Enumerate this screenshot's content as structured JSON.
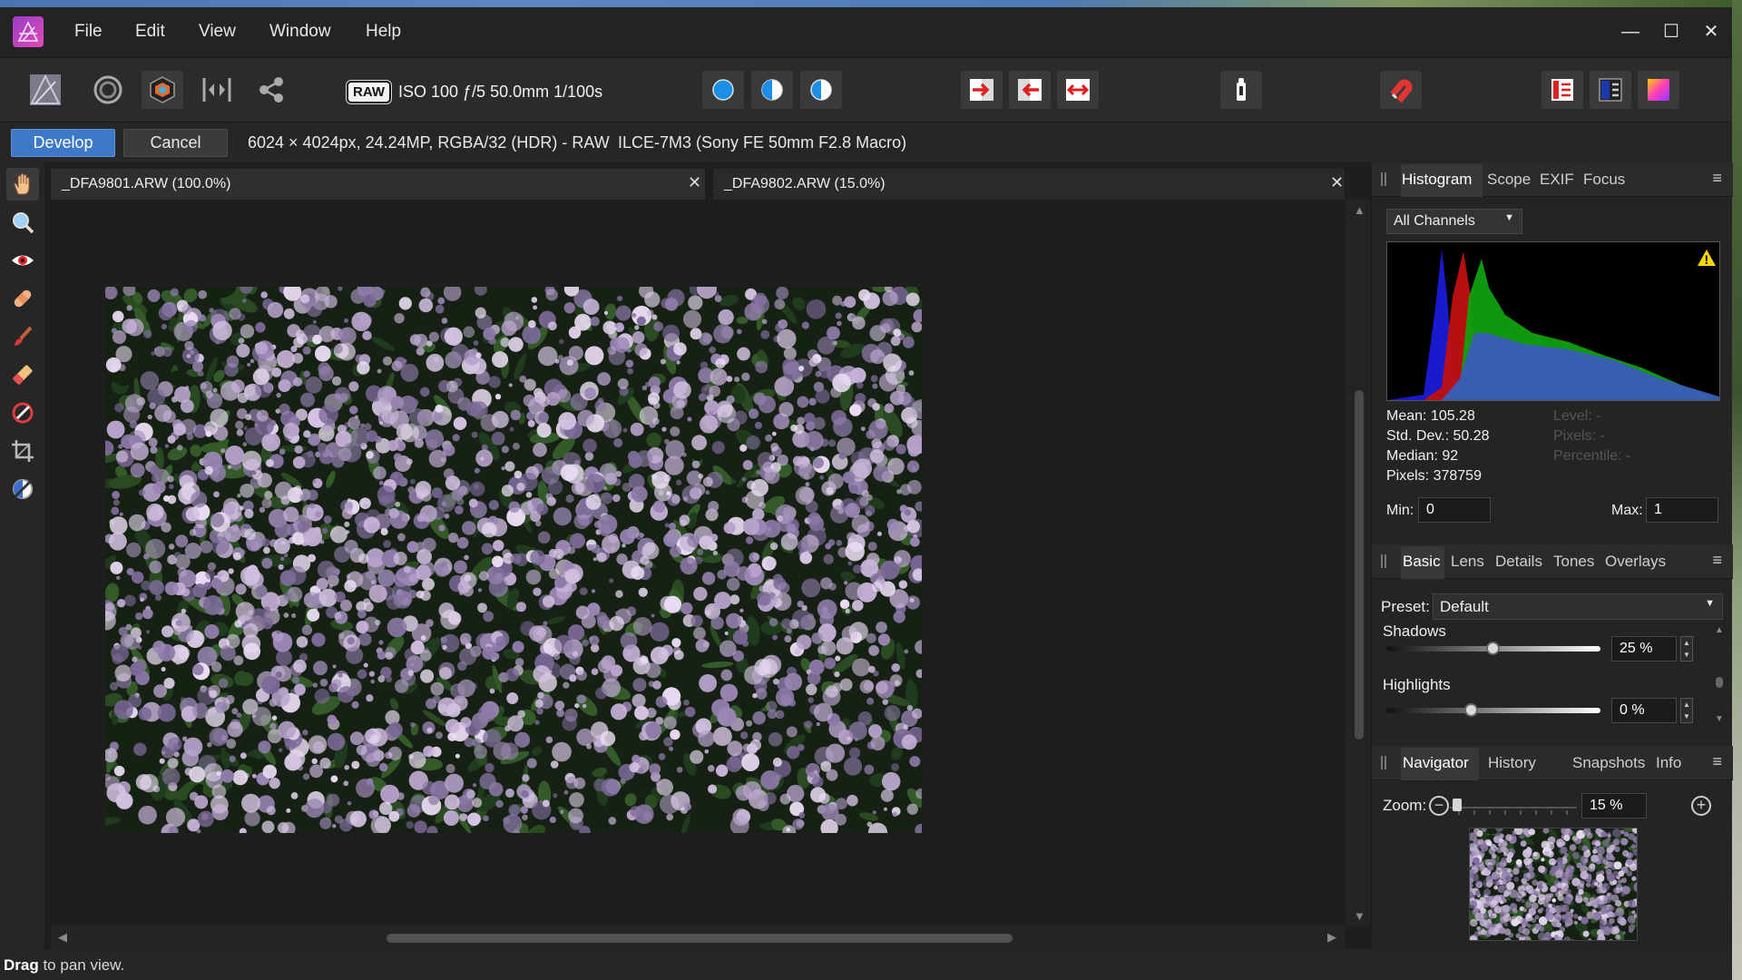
{
  "menu": {
    "items": [
      "File",
      "Edit",
      "View",
      "Window",
      "Help"
    ]
  },
  "window_controls": {
    "minimize": "—",
    "maximize": "☐",
    "close": "✕"
  },
  "toolbar": {
    "raw_badge": "RAW",
    "exposure_info": "ISO 100 ƒ/5 50.0mm 1/100s"
  },
  "context_bar": {
    "develop_label": "Develop",
    "cancel_label": "Cancel",
    "image_info": "6024 × 4024px, 24.24MP, RGBA/32 (HDR) - RAW",
    "camera_info": "ILCE-7M3 (Sony FE 50mm F2.8 Macro)"
  },
  "documents": [
    {
      "label": "_DFA9801.ARW (100.0%)",
      "close": "✕"
    },
    {
      "label": "_DFA9802.ARW (15.0%)",
      "close": "✕"
    }
  ],
  "histogram_panel": {
    "tabs": [
      "Histogram",
      "Scope",
      "EXIF",
      "Focus"
    ],
    "channel": "All Channels",
    "stats": {
      "mean": "Mean: 105.28",
      "std_dev": "Std. Dev.: 50.28",
      "median": "Median: 92",
      "pixels": "Pixels: 378759",
      "level": "Level: -",
      "pixels_r": "Pixels: -",
      "percentile": "Percentile: -"
    },
    "min_label": "Min:",
    "min_value": "0",
    "max_label": "Max:",
    "max_value": "1"
  },
  "basic_panel": {
    "tabs": [
      "Basic",
      "Lens",
      "Details",
      "Tones",
      "Overlays"
    ],
    "preset_label": "Preset:",
    "preset_value": "Default",
    "adjustments": [
      {
        "label": "Shadows",
        "value": "25 %",
        "level": 0.5
      },
      {
        "label": "Highlights",
        "value": "0 %",
        "level": 0.4
      }
    ]
  },
  "navigator_panel": {
    "tabs": [
      "Navigator",
      "History",
      "Snapshots",
      "Info"
    ],
    "zoom_label": "Zoom:",
    "zoom_value": "15 %"
  },
  "status": {
    "bold": "Drag",
    "text": " to pan view."
  },
  "colors": {
    "accent": "#3d79c6",
    "panel_bg": "#242424"
  }
}
